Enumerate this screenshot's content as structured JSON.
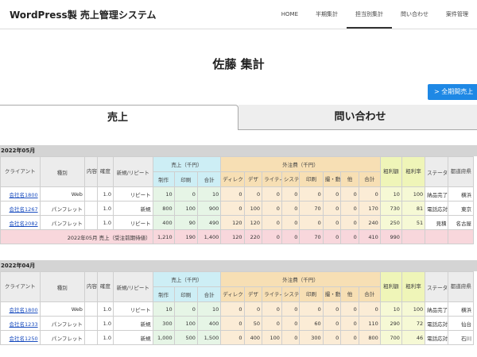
{
  "header": {
    "brand": "WordPress製 売上管理システム",
    "nav": [
      "HOME",
      "半期集計",
      "担当別集計",
      "問い合わせ",
      "案件管理"
    ],
    "active_nav": 2
  },
  "page": {
    "title": "佐藤 集計",
    "period_button": "> 全期間売上"
  },
  "tabs": [
    "売上",
    "問い合わせ"
  ],
  "table_headers": {
    "client": "クライアント",
    "type": "種別",
    "content": "内容",
    "accuracy": "確度",
    "new_repeat": "新規/リピート",
    "sales_group": "売上（千円）",
    "sales_cols": [
      "制作",
      "印刷",
      "合計"
    ],
    "outsourcing_group": "外注費（千円）",
    "outsourcing_cols": [
      "ディレク",
      "デザ",
      "ライティ",
      "システム",
      "印刷",
      "撮・動",
      "他",
      "合計"
    ],
    "profit": "粗利額",
    "profit_rate": "粗利率",
    "status": "ステータス",
    "region": "都道府県"
  },
  "sections": [
    {
      "month": "2022年05月",
      "rows": [
        {
          "client": "会社名1800",
          "type": "Web",
          "content": "",
          "acc": "1.0",
          "nr": "リピート",
          "s": [
            "10",
            "0",
            "10"
          ],
          "o": [
            "0",
            "0",
            "0",
            "0",
            "0",
            "0",
            "0",
            "0"
          ],
          "profit": "10",
          "rate": "100",
          "status": "納品完了",
          "region": "横浜"
        },
        {
          "client": "会社名1267",
          "type": "パンフレット",
          "content": "",
          "acc": "1.0",
          "nr": "新規",
          "s": [
            "800",
            "100",
            "900"
          ],
          "o": [
            "0",
            "100",
            "0",
            "0",
            "70",
            "0",
            "0",
            "170"
          ],
          "profit": "730",
          "rate": "81",
          "status": "電話応対",
          "region": "東京"
        },
        {
          "client": "会社名2082",
          "type": "パンフレット",
          "content": "",
          "acc": "1.0",
          "nr": "リピート",
          "s": [
            "400",
            "90",
            "490"
          ],
          "o": [
            "120",
            "120",
            "0",
            "0",
            "0",
            "0",
            "0",
            "240"
          ],
          "profit": "250",
          "rate": "51",
          "status": "見積",
          "region": "名古屋"
        }
      ],
      "total": {
        "label": "2022年05月 売上（受注前期待値）",
        "s": [
          "1,210",
          "190",
          "1,400"
        ],
        "o": [
          "120",
          "220",
          "0",
          "0",
          "70",
          "0",
          "0",
          "410"
        ],
        "profit": "990"
      }
    },
    {
      "month": "2022年04月",
      "rows": [
        {
          "client": "会社名1800",
          "type": "Web",
          "content": "",
          "acc": "1.0",
          "nr": "リピート",
          "s": [
            "10",
            "0",
            "10"
          ],
          "o": [
            "0",
            "0",
            "0",
            "0",
            "0",
            "0",
            "0",
            "0"
          ],
          "profit": "10",
          "rate": "100",
          "status": "納品完了",
          "region": "横浜"
        },
        {
          "client": "会社名1233",
          "type": "パンフレット",
          "content": "",
          "acc": "1.0",
          "nr": "新規",
          "s": [
            "300",
            "100",
            "400"
          ],
          "o": [
            "0",
            "50",
            "0",
            "0",
            "60",
            "0",
            "0",
            "110"
          ],
          "profit": "290",
          "rate": "72",
          "status": "電話応対",
          "region": "仙台"
        },
        {
          "client": "会社名1250",
          "type": "パンフレット",
          "content": "",
          "acc": "1.0",
          "nr": "新規",
          "s": [
            "1,000",
            "500",
            "1,500"
          ],
          "o": [
            "0",
            "400",
            "100",
            "0",
            "300",
            "0",
            "0",
            "800"
          ],
          "profit": "700",
          "rate": "46",
          "status": "電話応対",
          "region": "石川"
        }
      ]
    }
  ]
}
